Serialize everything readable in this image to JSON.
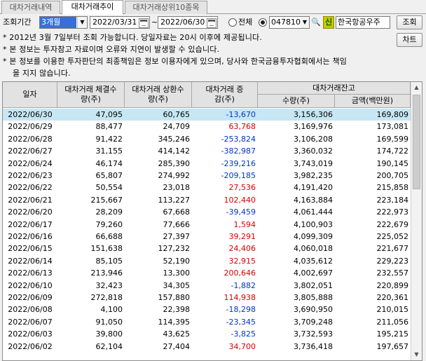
{
  "tabs": [
    "대차거래내역",
    "대차거래추이",
    "대차거래상위10종목"
  ],
  "active_tab": 1,
  "toolbar": {
    "period_label": "조회기간",
    "period_value": "3개월",
    "start_date": "2022/03/31",
    "tilde": "~",
    "end_date": "2022/06/30",
    "all_label": "전체",
    "stock_code": "047810",
    "new_badge": "신",
    "stock_name": "한국항공우주",
    "query_button": "조회",
    "chart_button": "차트"
  },
  "notices": [
    "* 2012년 3월 7일부터 조회 가능합니다. 당일자료는 20시 이후에 제공됩니다.",
    "* 본 정보는 투자참고 자료이며 오류와 지연이 발생할 수 있습니다.",
    "* 본 정보를 이용한 투자판단의 최종책임은 정보 이용자에게 있으며, 당사와 한국금융투자협회에서는 책임",
    "을 지지 않습니다."
  ],
  "table": {
    "headers": {
      "date": "일자",
      "contracted": "대차거래 체결수량(주)",
      "repaid": "대차거래 상환수량(주)",
      "change": "대차거래 증감(주)",
      "balance_group": "대차거래잔고",
      "balance_qty": "수량(주)",
      "balance_amt": "금액(백만원)"
    },
    "rows": [
      {
        "date": "2022/06/30",
        "contracted": "47,095",
        "repaid": "60,765",
        "change": "-13,670",
        "qty": "3,156,306",
        "amt": "169,809",
        "selected": true
      },
      {
        "date": "2022/06/29",
        "contracted": "88,477",
        "repaid": "24,709",
        "change": "63,768",
        "qty": "3,169,976",
        "amt": "173,081"
      },
      {
        "date": "2022/06/28",
        "contracted": "91,422",
        "repaid": "345,246",
        "change": "-253,824",
        "qty": "3,106,208",
        "amt": "169,599"
      },
      {
        "date": "2022/06/27",
        "contracted": "31,155",
        "repaid": "414,142",
        "change": "-382,987",
        "qty": "3,360,032",
        "amt": "174,722"
      },
      {
        "date": "2022/06/24",
        "contracted": "46,174",
        "repaid": "285,390",
        "change": "-239,216",
        "qty": "3,743,019",
        "amt": "190,145"
      },
      {
        "date": "2022/06/23",
        "contracted": "65,807",
        "repaid": "274,992",
        "change": "-209,185",
        "qty": "3,982,235",
        "amt": "200,705"
      },
      {
        "date": "2022/06/22",
        "contracted": "50,554",
        "repaid": "23,018",
        "change": "27,536",
        "qty": "4,191,420",
        "amt": "215,858"
      },
      {
        "date": "2022/06/21",
        "contracted": "215,667",
        "repaid": "113,227",
        "change": "102,440",
        "qty": "4,163,884",
        "amt": "223,184"
      },
      {
        "date": "2022/06/20",
        "contracted": "28,209",
        "repaid": "67,668",
        "change": "-39,459",
        "qty": "4,061,444",
        "amt": "222,973"
      },
      {
        "date": "2022/06/17",
        "contracted": "79,260",
        "repaid": "77,666",
        "change": "1,594",
        "qty": "4,100,903",
        "amt": "222,679"
      },
      {
        "date": "2022/06/16",
        "contracted": "66,688",
        "repaid": "27,397",
        "change": "39,291",
        "qty": "4,099,309",
        "amt": "225,052"
      },
      {
        "date": "2022/06/15",
        "contracted": "151,638",
        "repaid": "127,232",
        "change": "24,406",
        "qty": "4,060,018",
        "amt": "221,677"
      },
      {
        "date": "2022/06/14",
        "contracted": "85,105",
        "repaid": "52,190",
        "change": "32,915",
        "qty": "4,035,612",
        "amt": "229,223"
      },
      {
        "date": "2022/06/13",
        "contracted": "213,946",
        "repaid": "13,300",
        "change": "200,646",
        "qty": "4,002,697",
        "amt": "232,557"
      },
      {
        "date": "2022/06/10",
        "contracted": "32,423",
        "repaid": "34,305",
        "change": "-1,882",
        "qty": "3,802,051",
        "amt": "220,899"
      },
      {
        "date": "2022/06/09",
        "contracted": "272,818",
        "repaid": "157,880",
        "change": "114,938",
        "qty": "3,805,888",
        "amt": "220,361"
      },
      {
        "date": "2022/06/08",
        "contracted": "4,100",
        "repaid": "22,398",
        "change": "-18,298",
        "qty": "3,690,950",
        "amt": "210,015"
      },
      {
        "date": "2022/06/07",
        "contracted": "91,050",
        "repaid": "114,395",
        "change": "-23,345",
        "qty": "3,709,248",
        "amt": "211,056"
      },
      {
        "date": "2022/06/03",
        "contracted": "39,800",
        "repaid": "43,625",
        "change": "-3,825",
        "qty": "3,732,593",
        "amt": "195,215"
      },
      {
        "date": "2022/06/02",
        "contracted": "62,104",
        "repaid": "27,404",
        "change": "34,700",
        "qty": "3,736,418",
        "amt": "197,657"
      }
    ]
  },
  "colors": {
    "positive": "#d60000",
    "negative": "#0033cc",
    "selected_row": "#c6e7f3",
    "period_highlight": "#3a6fd8"
  }
}
